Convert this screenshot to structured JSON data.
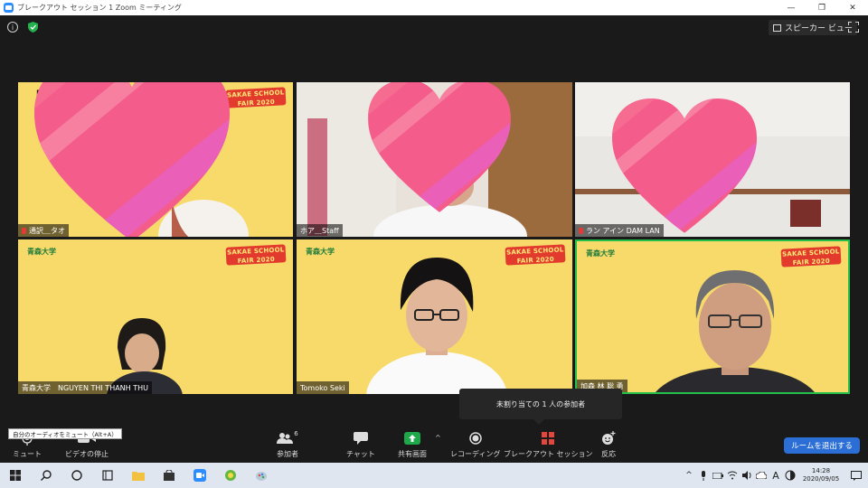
{
  "window": {
    "title": "ブレークアウト セッション 1  Zoom ミーティング",
    "controls": [
      "—",
      "❐",
      "✕"
    ]
  },
  "top": {
    "speaker_view_label": "スピーカー ビュー"
  },
  "tiles": [
    {
      "id": "t1",
      "name": "通訳＿タオ",
      "muted": true,
      "fair_logo": "SAKAE SCHOOL FAIR 2020",
      "partial_text": "PI"
    },
    {
      "id": "t2",
      "name": "ホア＿Staff",
      "muted": false
    },
    {
      "id": "t3",
      "name": "ラン  アイン DAM LAN",
      "muted": true
    },
    {
      "id": "t4",
      "name": "青森大学　NGUYEN THI THANH THU",
      "muted": false,
      "uni_logo": "青森大学",
      "fair_logo": "SAKAE SCHOOL FAIR 2020"
    },
    {
      "id": "t5",
      "name": "Tomoko Seki",
      "muted": false,
      "uni_logo": "青森大学",
      "fair_logo": "SAKAE SCHOOL FAIR 2020"
    },
    {
      "id": "t6",
      "name": "加森 林 聡 勇",
      "muted": false,
      "uni_logo": "青森大学",
      "fair_logo": "SAKAE SCHOOL FAIR 2020"
    }
  ],
  "tooltip": {
    "text": "未割り当ての 1 人の参加者"
  },
  "mute_tooltip": "自分のオーディオをミュート（Alt+A）",
  "toolbar": {
    "mute_label": "ミュート",
    "video_label": "ビデオの停止",
    "participants_label": "参加者",
    "participants_count": "6",
    "chat_label": "チャット",
    "share_label": "共有画面",
    "record_label": "レコーディング",
    "breakout_label": "ブレークアウト セッション",
    "reactions_label": "反応",
    "leave_label": "ルームを退出する",
    "colors": {
      "share": "#1fa84a",
      "leave": "#2b6fd6",
      "breakout": "#e2463c"
    }
  },
  "taskbar": {
    "time": "14:28",
    "date": "2020/09/05",
    "ime": "A",
    "icons": [
      "windows-icon",
      "search-icon",
      "cortana-icon",
      "task-view-icon",
      "file-explorer-icon",
      "store-icon",
      "zoom-icon",
      "app-green-icon",
      "paint-icon"
    ]
  }
}
